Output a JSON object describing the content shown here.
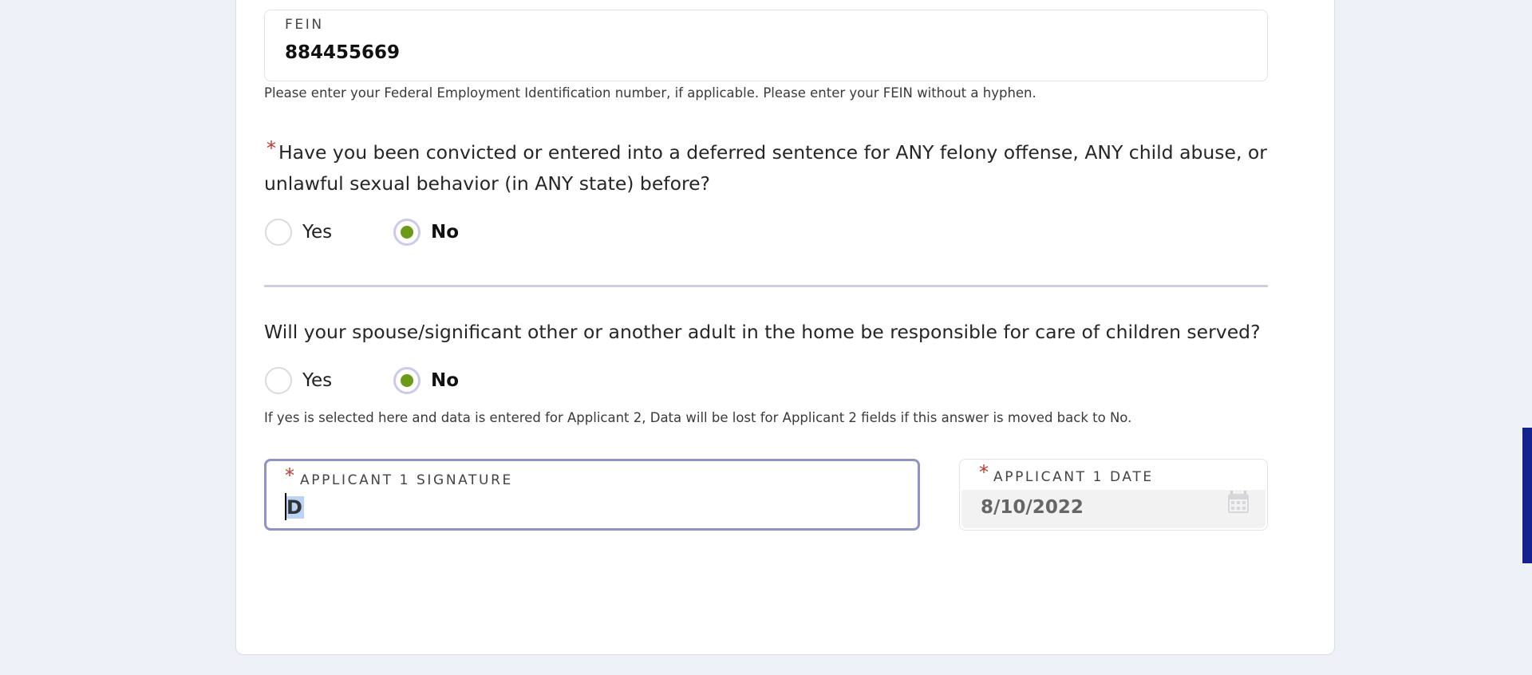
{
  "fein": {
    "label": "FEIN",
    "value": "884455669",
    "hint": "Please enter your Federal Employment Identification number, if applicable. Please enter your FEIN without a hyphen."
  },
  "question1": {
    "required_mark": "*",
    "text": "Have you been convicted or entered into a deferred sentence for ANY felony offense, ANY child abuse, or unlawful sexual behavior (in ANY state) before?",
    "options": [
      "Yes",
      "No"
    ],
    "selected": "No"
  },
  "question2": {
    "text": "Will your spouse/significant other or another adult in the home be responsible for care of children served?",
    "options": [
      "Yes",
      "No"
    ],
    "selected": "No",
    "hint": "If yes is selected here and data is entered for Applicant 2, Data will be lost for Applicant 2 fields if this answer is moved back to No."
  },
  "signature": {
    "required_mark": "*",
    "label": "APPLICANT 1 SIGNATURE",
    "value": "D"
  },
  "date": {
    "required_mark": "*",
    "label": "APPLICANT 1 DATE",
    "value": "8/10/2022",
    "icon": "calendar-icon"
  },
  "colors": {
    "accent_selected": "#6b9a14",
    "required": "#c0392b",
    "focus_border": "#8f93c9",
    "scrollbar": "#14228f"
  }
}
